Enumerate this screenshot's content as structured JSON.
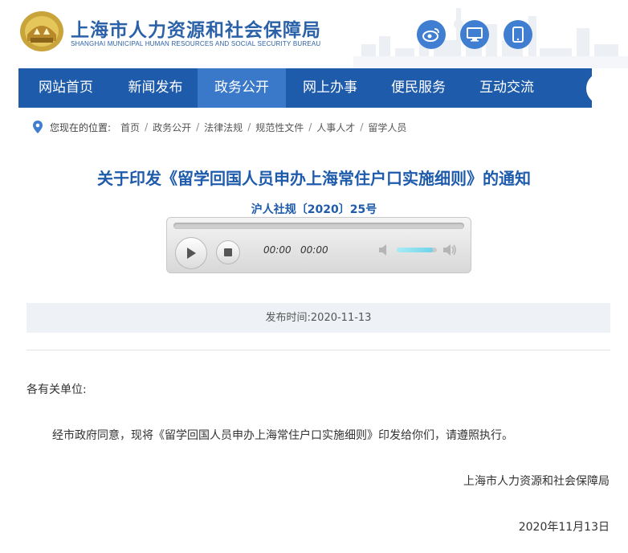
{
  "header": {
    "title_cn": "上海市人力资源和社会保障局",
    "title_en": "SHANGHAI MUNICIPAL HUMAN RESOURCES AND SOCIAL SECURITY BUREAU",
    "brand_color": "#2a61a8",
    "icons": [
      "weibo-icon",
      "desktop-icon",
      "mobile-icon"
    ]
  },
  "nav": {
    "items": [
      {
        "label": "网站首页",
        "active": false
      },
      {
        "label": "新闻发布",
        "active": false
      },
      {
        "label": "政务公开",
        "active": true
      },
      {
        "label": "网上办事",
        "active": false
      },
      {
        "label": "便民服务",
        "active": false
      },
      {
        "label": "互动交流",
        "active": false
      }
    ],
    "bg_color": "#1e5bab",
    "active_color": "#3a78c9"
  },
  "breadcrumb": {
    "prefix": "您现在的位置:",
    "items": [
      "首页",
      "政务公开",
      "法律法规",
      "规范性文件",
      "人事人才",
      "留学人员"
    ]
  },
  "article": {
    "title": "关于印发《留学回国人员申办上海常住户口实施细则》的通知",
    "doc_number": "沪人社规〔2020〕25号",
    "publish_label": "发布时间:",
    "publish_date": "2020-11-13",
    "salutation": "各有关单位:",
    "paragraph": "经市政府同意，现将《留学回国人员申办上海常住户口实施细则》印发给你们，请遵照执行。",
    "signature": "上海市人力资源和社会保障局",
    "sign_date": "2020年11月13日"
  },
  "player": {
    "current_time": "00:00",
    "duration": "00:00",
    "progress": 0,
    "volume": 0.9
  }
}
